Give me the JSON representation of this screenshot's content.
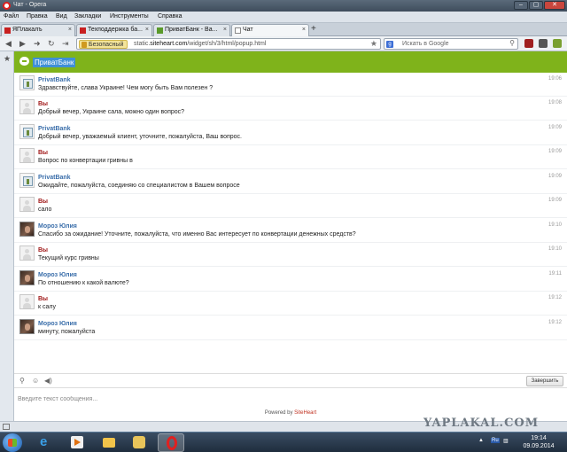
{
  "window": {
    "title": "Чат - Opera"
  },
  "menu": [
    "Файл",
    "Правка",
    "Вид",
    "Закладки",
    "Инструменты",
    "Справка"
  ],
  "tabs": [
    {
      "label": "ЯПлакалъ"
    },
    {
      "label": "Техподдержка ба..."
    },
    {
      "label": "ПриватБанк - Ва..."
    },
    {
      "label": "Чат"
    }
  ],
  "address": {
    "security_label": "Безопасный",
    "url_prefix": "static.",
    "url_domain": "siteheart.com",
    "url_path": "/widget/sh/3/html/popup.html"
  },
  "search": {
    "placeholder": "Искать в Google"
  },
  "chat": {
    "title": "ПриватБанк",
    "messages": [
      {
        "sender": "PrivatBank",
        "role": "bank",
        "text": "Здравствуйте, слава Украине! Чем могу быть Вам полезен ?",
        "time": "19:06"
      },
      {
        "sender": "Вы",
        "role": "you",
        "text": "Добрый вечер, Украине сала, можно один вопрос?",
        "time": "19:08"
      },
      {
        "sender": "PrivatBank",
        "role": "bank",
        "text": "Добрый вечер,  уважаемый клиент, уточните, пожалуйста, Ваш вопрос.",
        "time": "19:09"
      },
      {
        "sender": "Вы",
        "role": "you",
        "text": "Вопрос по конвертации гривны в",
        "time": "19:09"
      },
      {
        "sender": "PrivatBank",
        "role": "bank",
        "text": "Ожидайте, пожалуйста, соединяю со специалистом в Вашем вопросе",
        "time": "19:09"
      },
      {
        "sender": "Вы",
        "role": "you",
        "text": "сало",
        "time": "19:09"
      },
      {
        "sender": "Мороз Юлия",
        "role": "op",
        "text": "Спасибо за ожидание! Уточните, пожалуйста, что именно Вас интересует по конвертации денежных средств?",
        "time": "19:10"
      },
      {
        "sender": "Вы",
        "role": "you",
        "text": "Текущий курс гривны",
        "time": "19:10"
      },
      {
        "sender": "Мороз Юлия",
        "role": "op",
        "text": "По отношению к какой валюте?",
        "time": "19:11"
      },
      {
        "sender": "Вы",
        "role": "you",
        "text": "к салу",
        "time": "19:12"
      },
      {
        "sender": "Мороз Юлия",
        "role": "op",
        "text": "минуту, пожалуйста",
        "time": "19:12"
      }
    ],
    "input_placeholder": "Введите текст сообщения...",
    "send_label": "Завершить",
    "powered_prefix": "Powered by ",
    "powered_brand": "SiteHeart"
  },
  "watermark": "YAPLAKAL.COM",
  "taskbar": {
    "lang": "Ru",
    "time": "19:14",
    "date": "09.09.2014"
  },
  "colors": {
    "header_green": "#7fb31b",
    "title_highlight": "#3f8fd6",
    "sender_bank": "#3a6eaa",
    "sender_you": "#a01818"
  }
}
